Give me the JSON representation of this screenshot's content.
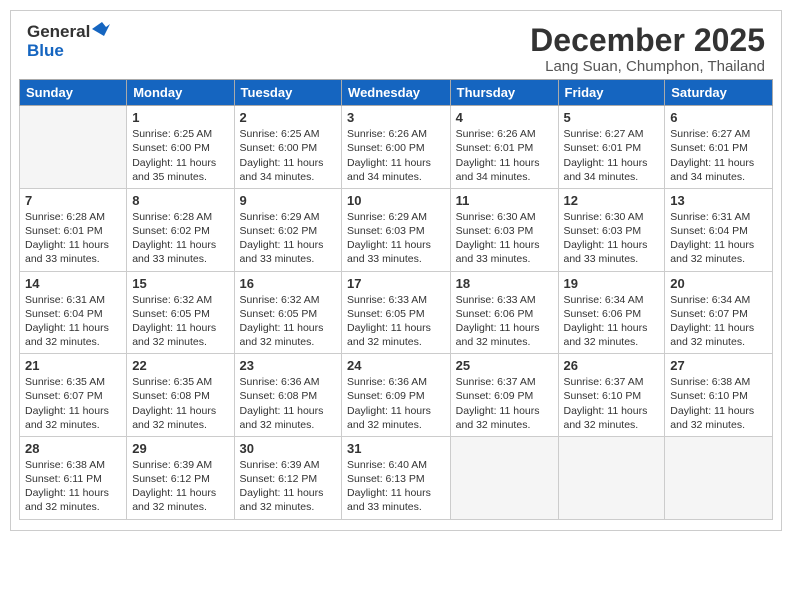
{
  "header": {
    "logo_line1": "General",
    "logo_line2": "Blue",
    "title": "December 2025",
    "subtitle": "Lang Suan, Chumphon, Thailand"
  },
  "calendar": {
    "weekdays": [
      "Sunday",
      "Monday",
      "Tuesday",
      "Wednesday",
      "Thursday",
      "Friday",
      "Saturday"
    ],
    "rows": [
      [
        {
          "day": "",
          "info": ""
        },
        {
          "day": "1",
          "info": "Sunrise: 6:25 AM\nSunset: 6:00 PM\nDaylight: 11 hours\nand 35 minutes."
        },
        {
          "day": "2",
          "info": "Sunrise: 6:25 AM\nSunset: 6:00 PM\nDaylight: 11 hours\nand 34 minutes."
        },
        {
          "day": "3",
          "info": "Sunrise: 6:26 AM\nSunset: 6:00 PM\nDaylight: 11 hours\nand 34 minutes."
        },
        {
          "day": "4",
          "info": "Sunrise: 6:26 AM\nSunset: 6:01 PM\nDaylight: 11 hours\nand 34 minutes."
        },
        {
          "day": "5",
          "info": "Sunrise: 6:27 AM\nSunset: 6:01 PM\nDaylight: 11 hours\nand 34 minutes."
        },
        {
          "day": "6",
          "info": "Sunrise: 6:27 AM\nSunset: 6:01 PM\nDaylight: 11 hours\nand 34 minutes."
        }
      ],
      [
        {
          "day": "7",
          "info": "Sunrise: 6:28 AM\nSunset: 6:01 PM\nDaylight: 11 hours\nand 33 minutes."
        },
        {
          "day": "8",
          "info": "Sunrise: 6:28 AM\nSunset: 6:02 PM\nDaylight: 11 hours\nand 33 minutes."
        },
        {
          "day": "9",
          "info": "Sunrise: 6:29 AM\nSunset: 6:02 PM\nDaylight: 11 hours\nand 33 minutes."
        },
        {
          "day": "10",
          "info": "Sunrise: 6:29 AM\nSunset: 6:03 PM\nDaylight: 11 hours\nand 33 minutes."
        },
        {
          "day": "11",
          "info": "Sunrise: 6:30 AM\nSunset: 6:03 PM\nDaylight: 11 hours\nand 33 minutes."
        },
        {
          "day": "12",
          "info": "Sunrise: 6:30 AM\nSunset: 6:03 PM\nDaylight: 11 hours\nand 33 minutes."
        },
        {
          "day": "13",
          "info": "Sunrise: 6:31 AM\nSunset: 6:04 PM\nDaylight: 11 hours\nand 32 minutes."
        }
      ],
      [
        {
          "day": "14",
          "info": "Sunrise: 6:31 AM\nSunset: 6:04 PM\nDaylight: 11 hours\nand 32 minutes."
        },
        {
          "day": "15",
          "info": "Sunrise: 6:32 AM\nSunset: 6:05 PM\nDaylight: 11 hours\nand 32 minutes."
        },
        {
          "day": "16",
          "info": "Sunrise: 6:32 AM\nSunset: 6:05 PM\nDaylight: 11 hours\nand 32 minutes."
        },
        {
          "day": "17",
          "info": "Sunrise: 6:33 AM\nSunset: 6:05 PM\nDaylight: 11 hours\nand 32 minutes."
        },
        {
          "day": "18",
          "info": "Sunrise: 6:33 AM\nSunset: 6:06 PM\nDaylight: 11 hours\nand 32 minutes."
        },
        {
          "day": "19",
          "info": "Sunrise: 6:34 AM\nSunset: 6:06 PM\nDaylight: 11 hours\nand 32 minutes."
        },
        {
          "day": "20",
          "info": "Sunrise: 6:34 AM\nSunset: 6:07 PM\nDaylight: 11 hours\nand 32 minutes."
        }
      ],
      [
        {
          "day": "21",
          "info": "Sunrise: 6:35 AM\nSunset: 6:07 PM\nDaylight: 11 hours\nand 32 minutes."
        },
        {
          "day": "22",
          "info": "Sunrise: 6:35 AM\nSunset: 6:08 PM\nDaylight: 11 hours\nand 32 minutes."
        },
        {
          "day": "23",
          "info": "Sunrise: 6:36 AM\nSunset: 6:08 PM\nDaylight: 11 hours\nand 32 minutes."
        },
        {
          "day": "24",
          "info": "Sunrise: 6:36 AM\nSunset: 6:09 PM\nDaylight: 11 hours\nand 32 minutes."
        },
        {
          "day": "25",
          "info": "Sunrise: 6:37 AM\nSunset: 6:09 PM\nDaylight: 11 hours\nand 32 minutes."
        },
        {
          "day": "26",
          "info": "Sunrise: 6:37 AM\nSunset: 6:10 PM\nDaylight: 11 hours\nand 32 minutes."
        },
        {
          "day": "27",
          "info": "Sunrise: 6:38 AM\nSunset: 6:10 PM\nDaylight: 11 hours\nand 32 minutes."
        }
      ],
      [
        {
          "day": "28",
          "info": "Sunrise: 6:38 AM\nSunset: 6:11 PM\nDaylight: 11 hours\nand 32 minutes."
        },
        {
          "day": "29",
          "info": "Sunrise: 6:39 AM\nSunset: 6:12 PM\nDaylight: 11 hours\nand 32 minutes."
        },
        {
          "day": "30",
          "info": "Sunrise: 6:39 AM\nSunset: 6:12 PM\nDaylight: 11 hours\nand 32 minutes."
        },
        {
          "day": "31",
          "info": "Sunrise: 6:40 AM\nSunset: 6:13 PM\nDaylight: 11 hours\nand 33 minutes."
        },
        {
          "day": "",
          "info": ""
        },
        {
          "day": "",
          "info": ""
        },
        {
          "day": "",
          "info": ""
        }
      ]
    ]
  }
}
